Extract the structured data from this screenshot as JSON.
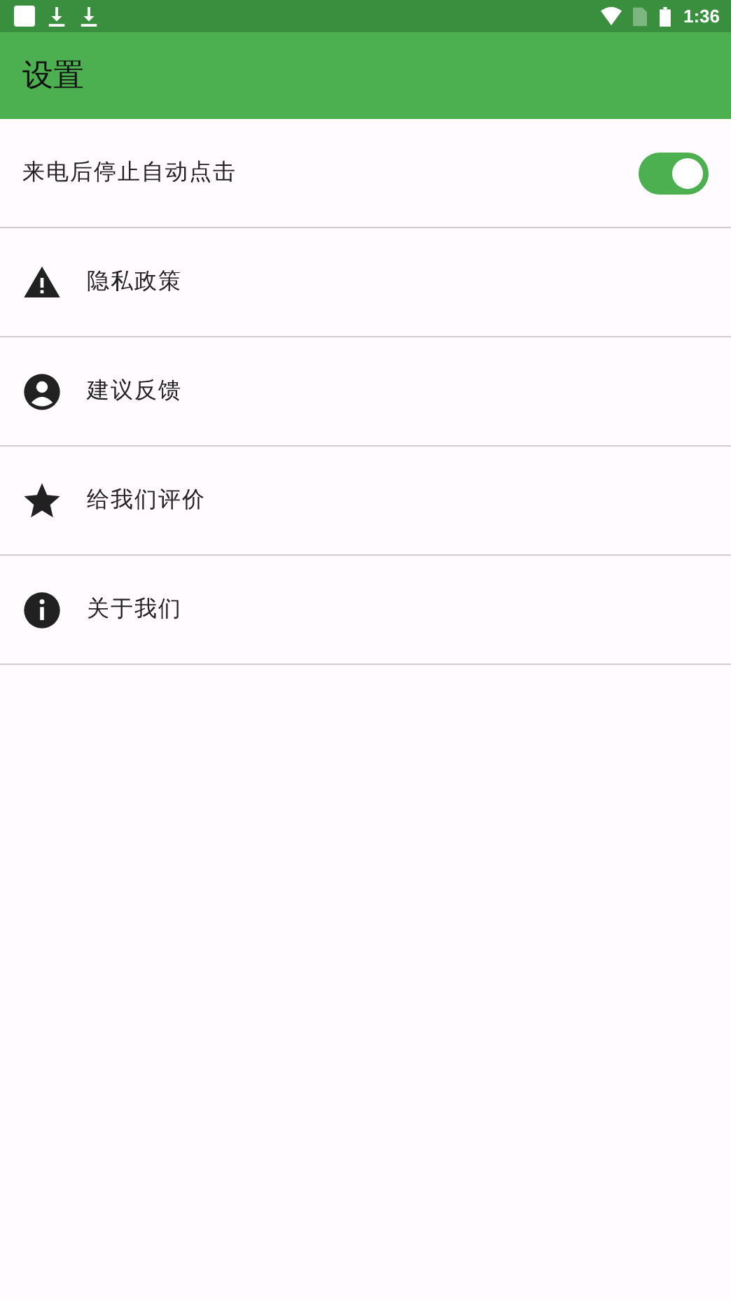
{
  "status_bar": {
    "time": "1:36"
  },
  "app_bar": {
    "title": "设置"
  },
  "settings": [
    {
      "kind": "switch",
      "label": "来电后停止自动点击",
      "on": true
    },
    {
      "kind": "warning",
      "label": "隐私政策"
    },
    {
      "kind": "account",
      "label": "建议反馈"
    },
    {
      "kind": "star",
      "label": "给我们评价"
    },
    {
      "kind": "info",
      "label": "关于我们"
    }
  ]
}
